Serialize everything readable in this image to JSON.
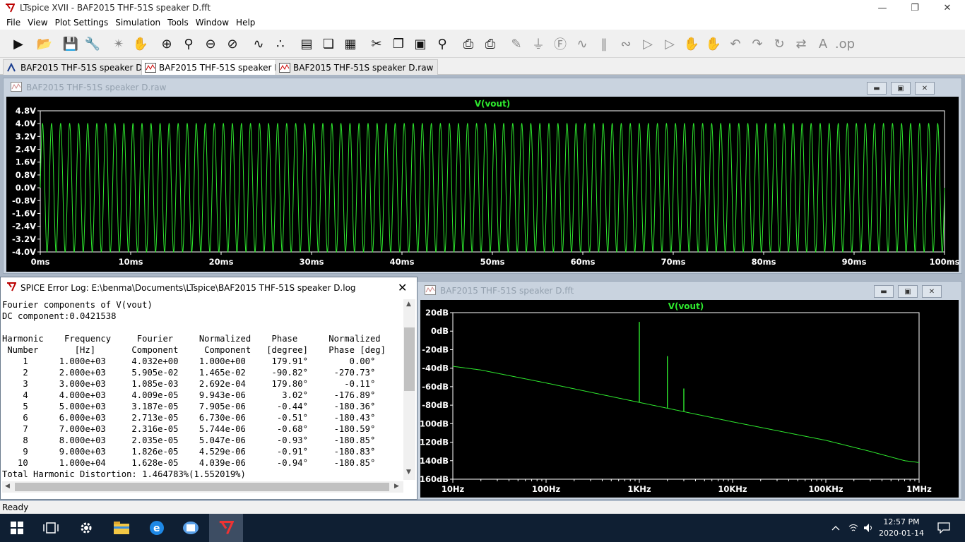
{
  "window": {
    "title": "LTspice XVII - BAF2015 THF-51S speaker D.fft"
  },
  "menu": [
    "File",
    "View",
    "Plot Settings",
    "Simulation",
    "Tools",
    "Window",
    "Help"
  ],
  "toolbar_icons": [
    "run-icon",
    "open-icon",
    "save-icon",
    "control-panel-icon",
    "halt-icon",
    "pan-icon",
    "zoom-in-icon",
    "zoom-fit-icon",
    "zoom-out-icon",
    "zoom-cancel-icon",
    "autorange-icon",
    "fft-icon",
    "tile-horizontal-icon",
    "cascade-icon",
    "tile-vertical-icon",
    "cut-icon",
    "copy-icon",
    "paste-icon",
    "find-icon",
    "print-icon",
    "print-setup-icon",
    "wire-icon",
    "ground-icon",
    "label-icon",
    "resistor-icon",
    "capacitor-icon",
    "inductor-icon",
    "diode-icon",
    "component-icon",
    "move-icon",
    "drag-icon",
    "undo-icon",
    "redo-icon",
    "rotate-icon",
    "mirror-icon",
    "text-icon",
    "spice-directive-icon"
  ],
  "tabs": [
    {
      "label": "BAF2015 THF-51S speaker D.asc",
      "icon": "schematic-icon"
    },
    {
      "label": "BAF2015 THF-51S speaker D.fft",
      "icon": "waveform-icon"
    },
    {
      "label": "BAF2015 THF-51S speaker D.raw",
      "icon": "waveform-icon"
    }
  ],
  "raw_window": {
    "title": "BAF2015 THF-51S speaker D.raw"
  },
  "fft_window": {
    "title": "BAF2015 THF-51S speaker D.fft"
  },
  "log_window": {
    "title": "SPICE Error Log: E:\\benma\\Documents\\LTspice\\BAF2015 THF-51S speaker D.log",
    "lines": [
      "Fourier components of V(vout)",
      "DC component:0.0421538",
      "",
      "Harmonic    Frequency     Fourier     Normalized    Phase      Normalized",
      " Number       [Hz]       Component     Component   [degree]    Phase [deg]",
      "    1      1.000e+03     4.032e+00    1.000e+00     179.91°        0.00°",
      "    2      2.000e+03     5.905e-02    1.465e-02     -90.82°     -270.73°",
      "    3      3.000e+03     1.085e-03    2.692e-04     179.80°       -0.11°",
      "    4      4.000e+03     4.009e-05    9.943e-06       3.02°     -176.89°",
      "    5      5.000e+03     3.187e-05    7.905e-06      -0.44°     -180.36°",
      "    6      6.000e+03     2.713e-05    6.730e-06      -0.51°     -180.43°",
      "    7      7.000e+03     2.316e-05    5.744e-06      -0.68°     -180.59°",
      "    8      8.000e+03     2.035e-05    5.047e-06      -0.93°     -180.85°",
      "    9      9.000e+03     1.826e-05    4.529e-06      -0.91°     -180.83°",
      "   10      1.000e+04     1.628e-05    4.039e-06      -0.94°     -180.85°",
      "Total Harmonic Distortion: 1.464783%(1.552019%)"
    ]
  },
  "status": "Ready",
  "clock": {
    "time": "12:57 PM",
    "date": "2020-01-14"
  },
  "taskbar_icons": [
    "windows-start-icon",
    "task-view-icon",
    "settings-icon",
    "file-explorer-icon",
    "edge-icon",
    "network-app-icon",
    "ltspice-taskbar-icon"
  ],
  "tray_icons": [
    "tray-chevron-icon",
    "wifi-icon",
    "volume-icon",
    "notifications-icon"
  ],
  "colors": {
    "trace": "#2ee82e",
    "plot_bg": "#000000",
    "axis_label": "#ffffff"
  },
  "chart_data": [
    {
      "type": "line",
      "title": "V(vout)",
      "x_unit": "ms",
      "xlim": [
        0,
        100
      ],
      "ylim": [
        -4.0,
        4.8
      ],
      "x_ticks": [
        "0ms",
        "10ms",
        "20ms",
        "30ms",
        "40ms",
        "50ms",
        "60ms",
        "70ms",
        "80ms",
        "90ms",
        "100ms"
      ],
      "y_ticks": [
        "4.8V",
        "4.0V",
        "3.2V",
        "2.4V",
        "1.6V",
        "0.8V",
        "0.0V",
        "-0.8V",
        "-1.6V",
        "-2.4V",
        "-3.2V",
        "-4.0V"
      ],
      "series": [
        {
          "name": "V(vout)",
          "frequency_hz": 1000,
          "amplitude_v": 4.03,
          "cycles": 100
        }
      ]
    },
    {
      "type": "line",
      "title": "V(vout)",
      "x_scale": "log",
      "xlim": [
        10,
        1000000
      ],
      "ylim": [
        -160,
        20
      ],
      "x_ticks": [
        "10Hz",
        "100Hz",
        "1KHz",
        "10KHz",
        "100KHz",
        "1MHz"
      ],
      "y_ticks": [
        "20dB",
        "0dB",
        "-20dB",
        "-40dB",
        "-60dB",
        "-80dB",
        "-100dB",
        "-120dB",
        "-140dB",
        "-160dB"
      ],
      "series": [
        {
          "name": "V(vout)",
          "floor": [
            [
              10,
              -38
            ],
            [
              20,
              -42
            ],
            [
              100,
              -56
            ],
            [
              1000,
              -77
            ],
            [
              10000,
              -98
            ],
            [
              100000,
              -118
            ],
            [
              300000,
              -130
            ],
            [
              700000,
              -140
            ],
            [
              1000000,
              -142
            ]
          ],
          "peaks": [
            [
              1000,
              10
            ],
            [
              2000,
              -27
            ],
            [
              3000,
              -62
            ]
          ]
        }
      ]
    }
  ]
}
